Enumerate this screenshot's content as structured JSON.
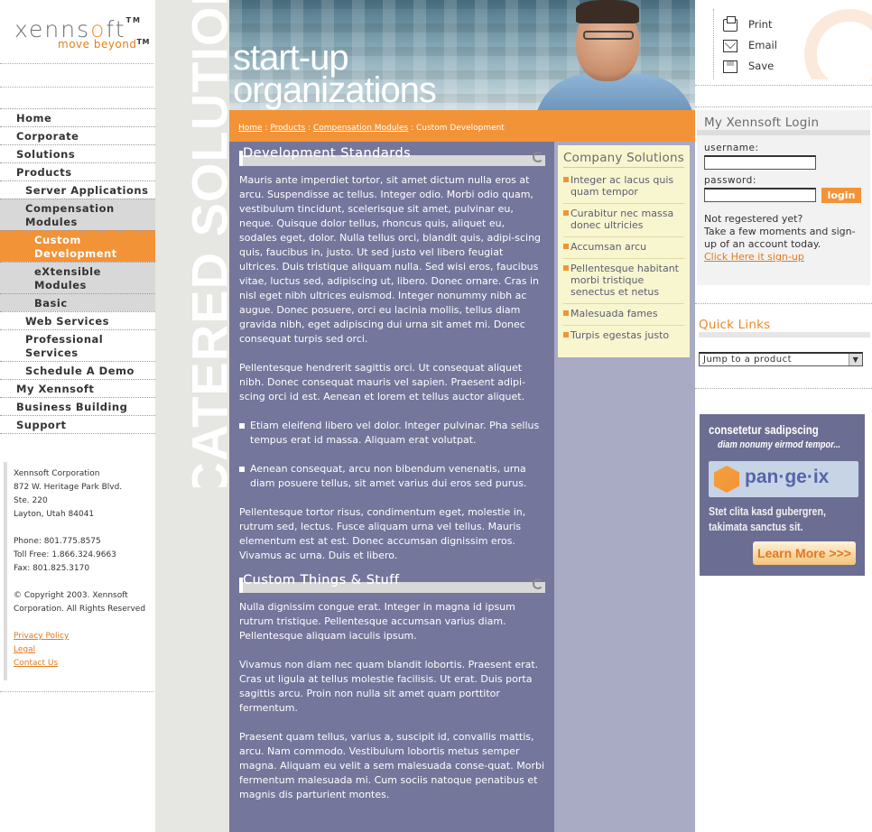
{
  "logo": {
    "brand_prefix": "xenns",
    "brand_o": "o",
    "brand_suffix": "ft",
    "tm": "TM",
    "tagline": "move beyond",
    "tagline_tm": "TM"
  },
  "nav": {
    "items": [
      {
        "label": "Home"
      },
      {
        "label": "Corporate"
      },
      {
        "label": "Solutions"
      },
      {
        "label": "Products"
      },
      {
        "label": "Server Applications"
      },
      {
        "label": "Compensation Modules"
      },
      {
        "label": "Custom Development"
      },
      {
        "label": "eXtensible Modules"
      },
      {
        "label": "Basic"
      },
      {
        "label": "Web Services"
      },
      {
        "label": "Professional Services"
      },
      {
        "label": "Schedule A Demo"
      },
      {
        "label": "My Xennsoft"
      },
      {
        "label": "Business Building"
      },
      {
        "label": "Support"
      }
    ]
  },
  "address": {
    "company": "Xennsoft Corporation",
    "street": "872 W. Heritage Park Blvd.",
    "suite": "Ste. 220",
    "city": "Layton, Utah 84041",
    "phone": "Phone: 801.775.8575",
    "tollfree": "Toll Free: 1.866.324.9663",
    "fax": "Fax: 801.825.3170",
    "copyright_1": "© Copyright 2003. Xennsoft",
    "copyright_2": "Corporation. All Rights Reserved",
    "links": {
      "privacy": "Privacy Policy",
      "legal": "Legal",
      "contact": "Contact Us"
    }
  },
  "strip_text": "CATERED SOLUTIONS",
  "hero": {
    "line1": "start-up",
    "line2": "organizations"
  },
  "breadcrumb": {
    "home": "Home",
    "products": "Products",
    "comp": "Compensation Modules",
    "current": "Custom Development",
    "sep": " : "
  },
  "main": {
    "section1_title": "Development Standards",
    "p1": "Mauris ante imperdiet tortor, sit amet dictum nulla eros at arcu. Suspendisse ac tellus. Integer odio. Morbi odio quam, vestibulum tincidunt, scelerisque sit amet, pulvinar eu, neque. Quisque dolor tellus, rhoncus quis, aliquet eu, sodales eget, dolor. Nulla tellus orci, blandit quis, adipi-scing quis, faucibus in, justo. Ut sed justo vel libero feugiat ultrices. Duis tristique aliquam nulla. Sed wisi eros, faucibus vitae, luctus sed, adipiscing ut, libero. Donec ornare. Cras in nisl eget nibh ultrices euismod. Integer nonummy nibh ac augue. Donec posuere, orci eu lacinia mollis, tellus diam gravida nibh, eget adipiscing dui urna sit amet mi. Donec consequat turpis sed orci.",
    "p2": "Pellentesque hendrerit sagittis orci. Ut consequat aliquet nibh. Donec consequat mauris vel sapien. Praesent adipi-scing orci id est. Aenean et lorem et tellus auctor aliquet.",
    "b1": "Etiam eleifend libero vel dolor. Integer pulvinar. Pha sellus tempus erat id massa. Aliquam erat volutpat.",
    "b2": "Aenean consequat, arcu non bibendum venenatis, urna diam posuere tellus, sit amet varius dui eros sed purus.",
    "p3": "Pellentesque tortor risus, condimentum eget, molestie in, rutrum sed, lectus. Fusce aliquam urna vel tellus. Mauris elementum est at est. Donec accumsan dignissim eros. Vivamus ac urna. Duis et libero.",
    "section2_title": "Custom Things & Stuff",
    "p4": "Nulla dignissim congue erat. Integer in magna id ipsum rutrum tristique. Pellentesque accumsan varius diam. Pellentesque aliquam iaculis ipsum.",
    "p5": "Vivamus non diam nec quam blandit lobortis. Praesent erat. Cras ut ligula at tellus molestie facilisis. Ut erat. Duis porta sagittis arcu. Proin non nulla sit amet quam porttitor fermentum.",
    "p6": "Praesent quam tellus, varius a, suscipit id, convallis mattis, arcu. Nam commodo. Vestibulum lobortis metus semper magna. Aliquam eu velit a sem malesuada conse-quat. Morbi fermentum malesuada mi. Cum sociis natoque penatibus et magnis dis parturient montes."
  },
  "solutions": {
    "title": "Company Solutions",
    "items": [
      {
        "label": "Integer ac lacus quis quam tempor"
      },
      {
        "label": "Curabitur nec massa donec ultricies"
      },
      {
        "label": "Accumsan arcu"
      },
      {
        "label": "Pellentesque habitant morbi tristique senectus et netus"
      },
      {
        "label": "Malesuada fames"
      },
      {
        "label": "Turpis egestas justo"
      }
    ]
  },
  "tools": {
    "print": "Print",
    "email": "Email",
    "save": "Save"
  },
  "login": {
    "title": "My Xennsoft Login",
    "username_label": "username:",
    "password_label": "password:",
    "button": "login",
    "not_registered": "Not regestered yet?",
    "blurb": "Take a few moments and sign-up of an account today.",
    "signup_link": "Click Here it sign-up"
  },
  "quick_links": {
    "title": "Quick Links",
    "select_value": "Jump to a product",
    "arrow": "▼"
  },
  "ad": {
    "line1": "consetetur sadipscing",
    "line2": "diam nonumy eirmod tempor...",
    "logo": "pan·ge·ix",
    "line3": "Stet clita kasd gubergren, takimata sanctus sit.",
    "button": "Learn More >>>"
  },
  "colors": {
    "accent": "#f39337",
    "main_bg": "#74769b",
    "side_bg": "#a9aac4",
    "solutions_bg": "#f8f6cf"
  }
}
